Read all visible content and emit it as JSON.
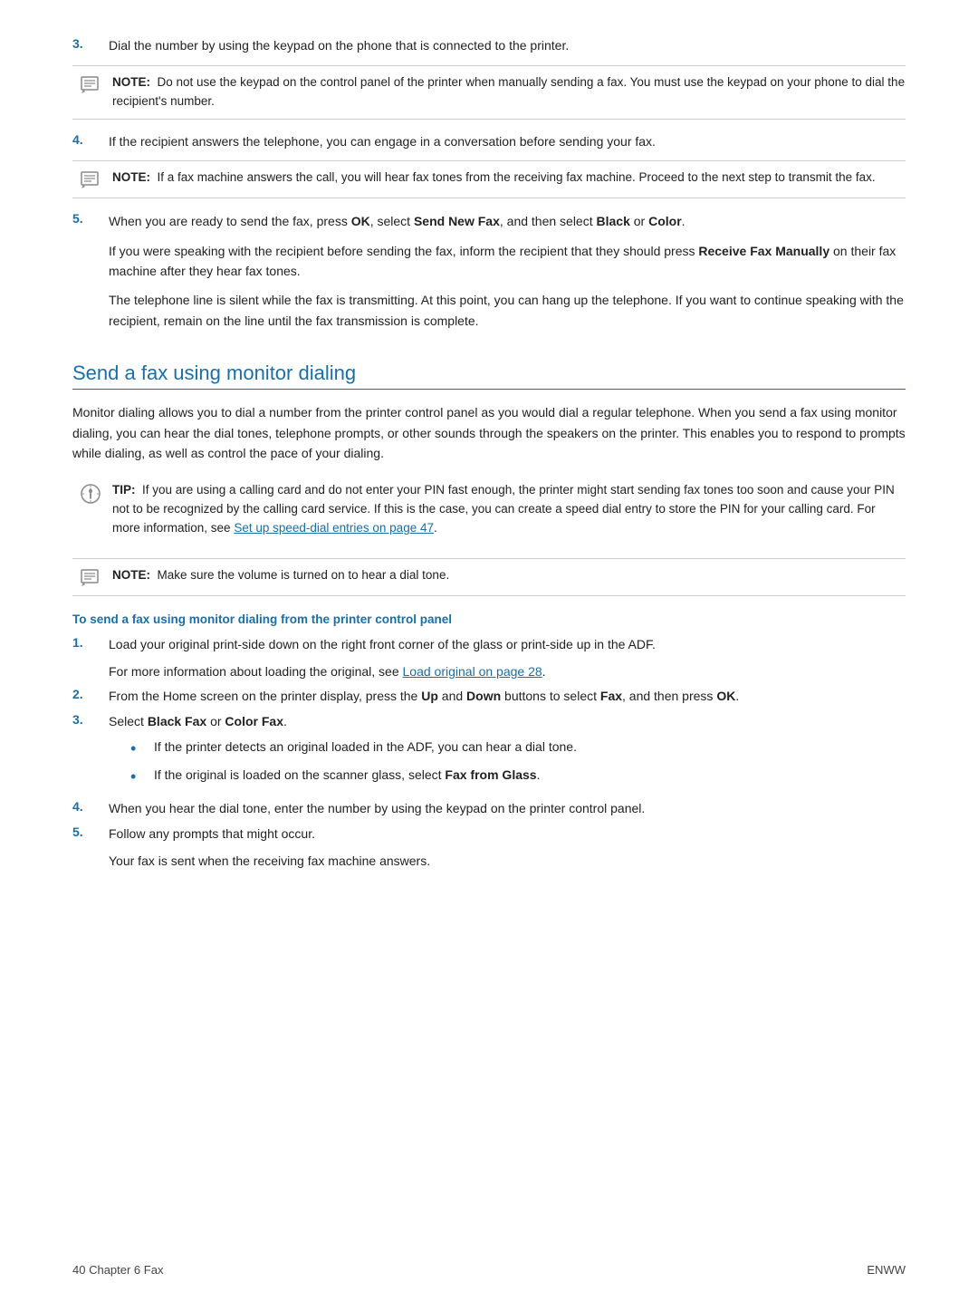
{
  "steps_initial": [
    {
      "number": "3.",
      "text": "Dial the number by using the keypad on the phone that is connected to the printer."
    },
    {
      "number": "4.",
      "text": "If the recipient answers the telephone, you can engage in a conversation before sending your fax."
    },
    {
      "number": "5.",
      "text_parts": [
        {
          "text": "When you are ready to send the fax, press ",
          "bold": false
        },
        {
          "text": "OK",
          "bold": true
        },
        {
          "text": ", select ",
          "bold": false
        },
        {
          "text": "Send New Fax",
          "bold": true
        },
        {
          "text": ", and then select ",
          "bold": false
        },
        {
          "text": "Black",
          "bold": true
        },
        {
          "text": " or ",
          "bold": false
        },
        {
          "text": "Color",
          "bold": true
        },
        {
          "text": ".",
          "bold": false
        }
      ],
      "extra_paragraphs": [
        {
          "text_parts": [
            {
              "text": "If you were speaking with the recipient before sending the fax, inform the recipient that they should press ",
              "bold": false
            },
            {
              "text": "Receive Fax Manually",
              "bold": true
            },
            {
              "text": " on their fax machine after they hear fax tones.",
              "bold": false
            }
          ]
        },
        {
          "text": "The telephone line is silent while the fax is transmitting. At this point, you can hang up the telephone. If you want to continue speaking with the recipient, remain on the line until the fax transmission is complete."
        }
      ]
    }
  ],
  "note1": {
    "label": "NOTE:",
    "text": "Do not use the keypad on the control panel of the printer when manually sending a fax. You must use the keypad on your phone to dial the recipient's number."
  },
  "note2": {
    "label": "NOTE:",
    "text": "If a fax machine answers the call, you will hear fax tones from the receiving fax machine. Proceed to the next step to transmit the fax."
  },
  "section_heading": "Send a fax using monitor dialing",
  "section_intro": "Monitor dialing allows you to dial a number from the printer control panel as you would dial a regular telephone. When you send a fax using monitor dialing, you can hear the dial tones, telephone prompts, or other sounds through the speakers on the printer. This enables you to respond to prompts while dialing, as well as control the pace of your dialing.",
  "tip": {
    "label": "TIP:",
    "text_parts": [
      {
        "text": "If you are using a calling card and do not enter your PIN fast enough, the printer might start sending fax tones too soon and cause your PIN not to be recognized by the calling card service. If this is the case, you can create a speed dial entry to store the PIN for your calling card. For more information, see ",
        "bold": false
      },
      {
        "text": "Set up speed-dial entries on page 47",
        "bold": false,
        "link": true
      },
      {
        "text": ".",
        "bold": false
      }
    ]
  },
  "note3": {
    "label": "NOTE:",
    "text": "Make sure the volume is turned on to hear a dial tone."
  },
  "sub_heading": "To send a fax using monitor dialing from the printer control panel",
  "monitor_steps": [
    {
      "number": "1.",
      "text": "Load your original print-side down on the right front corner of the glass or print-side up in the ADF.",
      "extra": {
        "text_parts": [
          {
            "text": "For more information about loading the original, see ",
            "bold": false
          },
          {
            "text": "Load original on page 28",
            "bold": false,
            "link": true
          },
          {
            "text": ".",
            "bold": false
          }
        ]
      }
    },
    {
      "number": "2.",
      "text_parts": [
        {
          "text": "From the Home screen on the printer display, press the ",
          "bold": false
        },
        {
          "text": "Up",
          "bold": true
        },
        {
          "text": " and ",
          "bold": false
        },
        {
          "text": "Down",
          "bold": true
        },
        {
          "text": " buttons to select ",
          "bold": false
        },
        {
          "text": "Fax",
          "bold": true
        },
        {
          "text": ", and then press ",
          "bold": false
        },
        {
          "text": "OK",
          "bold": true
        },
        {
          "text": ".",
          "bold": false
        }
      ]
    },
    {
      "number": "3.",
      "text_parts": [
        {
          "text": "Select ",
          "bold": false
        },
        {
          "text": "Black Fax",
          "bold": true
        },
        {
          "text": " or ",
          "bold": false
        },
        {
          "text": "Color Fax",
          "bold": true
        },
        {
          "text": ".",
          "bold": false
        }
      ],
      "sub_steps": [
        {
          "text": "If the printer detects an original loaded in the ADF, you can hear a dial tone."
        },
        {
          "text_parts": [
            {
              "text": "If the original is loaded on the scanner glass, select ",
              "bold": false
            },
            {
              "text": "Fax from Glass",
              "bold": true
            },
            {
              "text": ".",
              "bold": false
            }
          ]
        }
      ]
    },
    {
      "number": "4.",
      "text": "When you hear the dial tone, enter the number by using the keypad on the printer control panel."
    },
    {
      "number": "5.",
      "text": "Follow any prompts that might occur.",
      "extra": {
        "text": "Your fax is sent when the receiving fax machine answers."
      }
    }
  ],
  "footer": {
    "left": "40    Chapter 6   Fax",
    "right": "ENWW"
  }
}
